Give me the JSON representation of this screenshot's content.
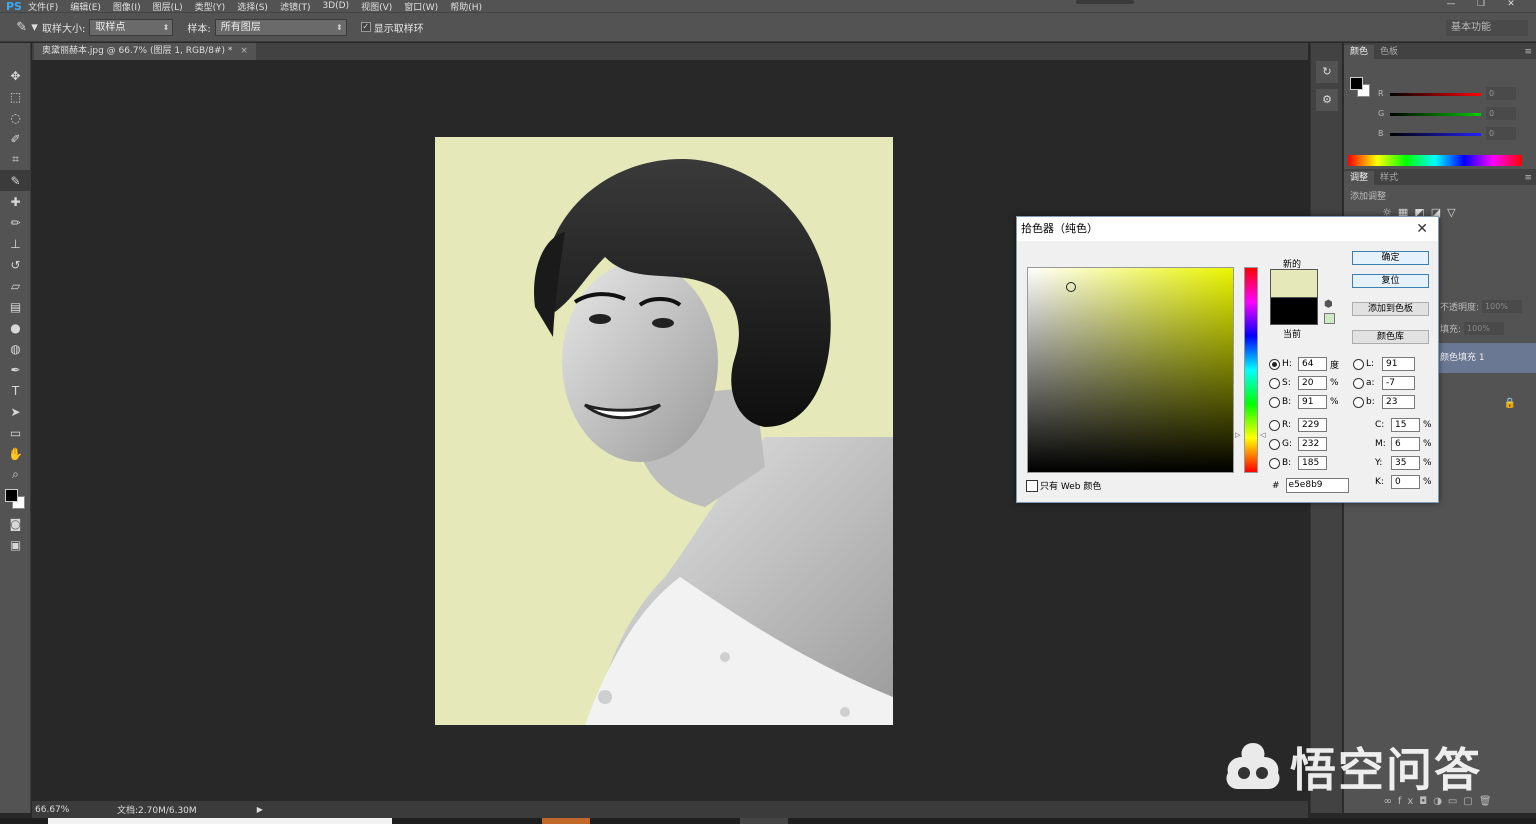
{
  "app": {
    "logo": "PS"
  },
  "menu": [
    "文件(F)",
    "编辑(E)",
    "图像(I)",
    "图层(L)",
    "类型(Y)",
    "选择(S)",
    "滤镜(T)",
    "3D(D)",
    "视图(V)",
    "窗口(W)",
    "帮助(H)"
  ],
  "window_controls": {
    "minimize": "—",
    "restore": "❐",
    "close": "✕"
  },
  "options": {
    "sample_size_label": "取样大小:",
    "sample_size_value": "取样点",
    "sample_label": "样本:",
    "sample_value": "所有图层",
    "show_ring_label": "显示取样环",
    "show_ring_checked": true,
    "workspace": "基本功能"
  },
  "document": {
    "tab_title": "奥黛丽赫本.jpg @ 66.7% (图层 1, RGB/8#) *",
    "close": "×",
    "background_color": "#e5e8b9"
  },
  "status": {
    "zoom": "66.67%",
    "doc_size": "文档:2.70M/6.30M",
    "arrow": "▶"
  },
  "tools": [
    "move-tool",
    "marquee-tool",
    "lasso-tool",
    "quick-select-tool",
    "crop-tool",
    "eyedropper-tool",
    "healing-brush-tool",
    "brush-tool",
    "clone-stamp-tool",
    "history-brush-tool",
    "eraser-tool",
    "gradient-tool",
    "blur-tool",
    "dodge-tool",
    "pen-tool",
    "type-tool",
    "path-select-tool",
    "shape-tool",
    "hand-tool",
    "zoom-tool"
  ],
  "color_panel": {
    "tabs": [
      "颜色",
      "色板"
    ],
    "channels": [
      {
        "label": "R",
        "value": "0",
        "color": "#d02020"
      },
      {
        "label": "G",
        "value": "0",
        "color": "#20b020"
      },
      {
        "label": "B",
        "value": "0",
        "color": "#2030d0"
      }
    ]
  },
  "adjust_panel": {
    "tabs": [
      "调整",
      "样式"
    ],
    "title": "添加调整"
  },
  "layers_panel": {
    "opacity_label": "不透明度:",
    "opacity_value": "100%",
    "fill_label": "填充:",
    "fill_value": "100%",
    "fill_layer_name": "颜色填充 1"
  },
  "picker": {
    "title": "拾色器（纯色）",
    "new_label": "新的",
    "current_label": "当前",
    "new_color": "#e5e8b9",
    "current_color": "#000000",
    "buttons": {
      "ok": "确定",
      "reset": "复位",
      "add_swatch": "添加到色板",
      "library": "颜色库"
    },
    "H": "64",
    "S": "20",
    "Bv": "91",
    "R": "229",
    "G": "232",
    "B": "185",
    "L": "91",
    "a": "-7",
    "b": "23",
    "C": "15",
    "M": "6",
    "Y": "35",
    "K": "0",
    "units": {
      "deg": "度",
      "pct": "%"
    },
    "labels": {
      "H": "H:",
      "S": "S:",
      "Bv": "B:",
      "R": "R:",
      "G": "G:",
      "B": "B:",
      "L": "L:",
      "a": "a:",
      "b": "b:",
      "C": "C:",
      "M": "M:",
      "Y": "Y:",
      "K": "K:"
    },
    "hash": "#",
    "hex": "e5e8b9",
    "web_only_label": "只有 Web 颜色"
  },
  "watermark": {
    "text": "悟空问答"
  }
}
